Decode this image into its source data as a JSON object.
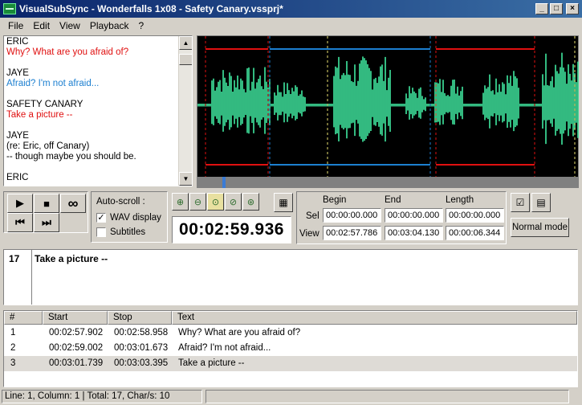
{
  "window": {
    "title": "VisualSubSync - Wonderfalls 1x08 - Safety Canary.vssprj*"
  },
  "menu": [
    "File",
    "Edit",
    "View",
    "Playback",
    "?"
  ],
  "text_pane": {
    "lines": [
      {
        "text": "ERIC",
        "style": "plain"
      },
      {
        "text": "Why? What are you afraid of?",
        "style": "red"
      },
      {
        "text": "",
        "style": "blank"
      },
      {
        "text": "JAYE",
        "style": "plain"
      },
      {
        "text": "Afraid? I'm not afraid...",
        "style": "blue"
      },
      {
        "text": "",
        "style": "blank"
      },
      {
        "text": "SAFETY CANARY",
        "style": "plain"
      },
      {
        "text": "Take a picture --",
        "style": "red"
      },
      {
        "text": "",
        "style": "blank"
      },
      {
        "text": "JAYE",
        "style": "plain"
      },
      {
        "text": "(re: Eric, off Canary)",
        "style": "plain"
      },
      {
        "text": "-- though maybe you should be.",
        "style": "plain"
      },
      {
        "text": "",
        "style": "blank"
      },
      {
        "text": "ERIC",
        "style": "plain"
      }
    ]
  },
  "transport": {
    "play": "▶",
    "stop": "■",
    "loop": "∞",
    "prev": "⏮",
    "next": "⏭"
  },
  "autoscroll": {
    "label": "Auto-scroll :",
    "wav_display_label": "WAV display",
    "wav_display_checked": true,
    "subtitles_label": "Subtitles",
    "subtitles_checked": false
  },
  "clock": "00:02:59.936",
  "times": {
    "begin_label": "Begin",
    "end_label": "End",
    "length_label": "Length",
    "sel_label": "Sel",
    "view_label": "View",
    "sel_begin": "00:00:00.000",
    "sel_end": "00:00:00.000",
    "sel_length": "00:00:00.000",
    "view_begin": "00:02:57.786",
    "view_end": "00:03:04.130",
    "view_length": "00:00:06.344"
  },
  "normal_mode_label": "Normal mode",
  "edit": {
    "index": "17",
    "text": "Take a picture --"
  },
  "list": {
    "columns": [
      "#",
      "Start",
      "Stop",
      "Text"
    ],
    "rows": [
      {
        "num": "1",
        "start": "00:02:57.902",
        "stop": "00:02:58.958",
        "text": "Why? What are you afraid of?",
        "selected": false
      },
      {
        "num": "2",
        "start": "00:02:59.002",
        "stop": "00:03:01.673",
        "text": "Afraid? I'm not afraid...",
        "selected": false
      },
      {
        "num": "3",
        "start": "00:03:01.739",
        "stop": "00:03:03.395",
        "text": "Take a picture --",
        "selected": true
      }
    ]
  },
  "status": "Line: 1, Column: 1 | Total: 17, Char/s: 10",
  "colors": {
    "waveform": "#40e8a0",
    "subtitle_red": "#e01010",
    "subtitle_blue": "#1c7fd0",
    "cursor_yellow": "#e8e070"
  }
}
